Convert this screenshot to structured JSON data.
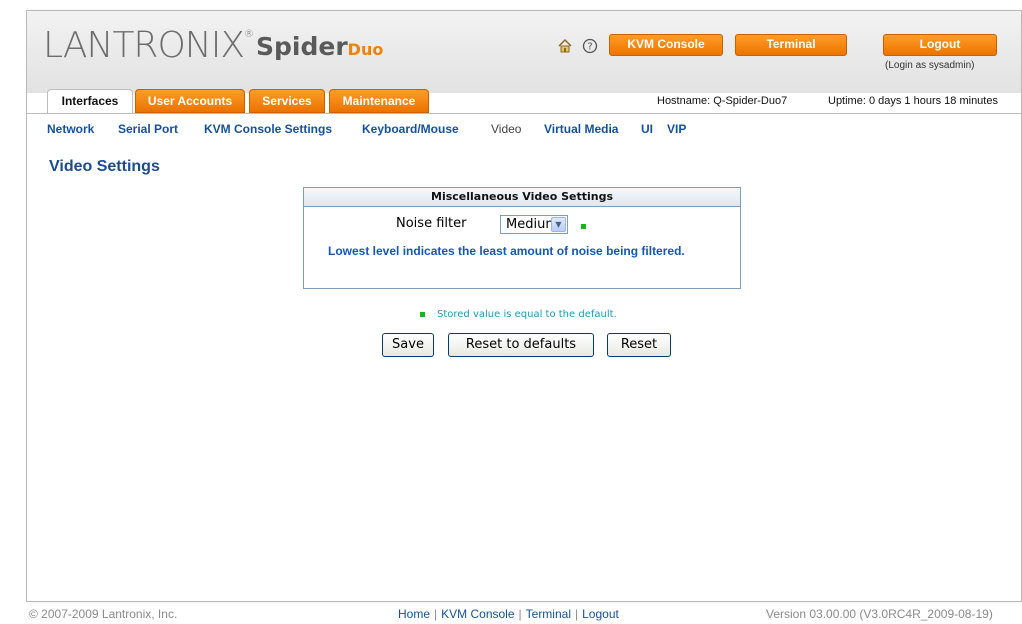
{
  "brand": {
    "logo": "LANTRONIX",
    "logo_mark": "®",
    "product": "Spider",
    "product_suffix": "Duo"
  },
  "header": {
    "kvm_console_label": "KVM Console",
    "terminal_label": "Terminal",
    "logout_label": "Logout",
    "login_as": "(Login as sysadmin)",
    "home_icon": "home-icon",
    "help_icon": "help-icon"
  },
  "tabs": [
    {
      "label": "Interfaces",
      "active": true
    },
    {
      "label": "User Accounts",
      "active": false
    },
    {
      "label": "Services",
      "active": false
    },
    {
      "label": "Maintenance",
      "active": false
    }
  ],
  "hostinfo": {
    "hostname": "Hostname: Q-Spider-Duo7",
    "uptime": "Uptime: 0 days 1 hours 18 minutes"
  },
  "subnav": [
    {
      "label": "Network"
    },
    {
      "label": "Serial Port"
    },
    {
      "label": "KVM Console Settings"
    },
    {
      "label": "Keyboard/Mouse"
    },
    {
      "label": "Video",
      "current": true
    },
    {
      "label": "Virtual Media"
    },
    {
      "label": "UI"
    },
    {
      "label": "VIP"
    }
  ],
  "page": {
    "title": "Video Settings"
  },
  "misc_box": {
    "title": "Miscellaneous Video Settings",
    "noise_filter_label": "Noise filter",
    "noise_filter_value": "Medium",
    "help_text": "Lowest level indicates the least amount of noise being filtered."
  },
  "legend": {
    "text": "Stored value is equal to the default."
  },
  "buttons": {
    "save": "Save",
    "reset_defaults": "Reset to defaults",
    "reset": "Reset"
  },
  "footer": {
    "copyright": "© 2007-2009 Lantronix, Inc.",
    "links": [
      "Home",
      "KVM Console",
      "Terminal",
      "Logout"
    ],
    "version": "Version 03.00.00 (V3.0RC4R_2009-08-19)"
  },
  "colors": {
    "accent": "#f08200",
    "link": "#14519c",
    "title": "#1d4b8f",
    "default_indicator": "#19b619"
  }
}
